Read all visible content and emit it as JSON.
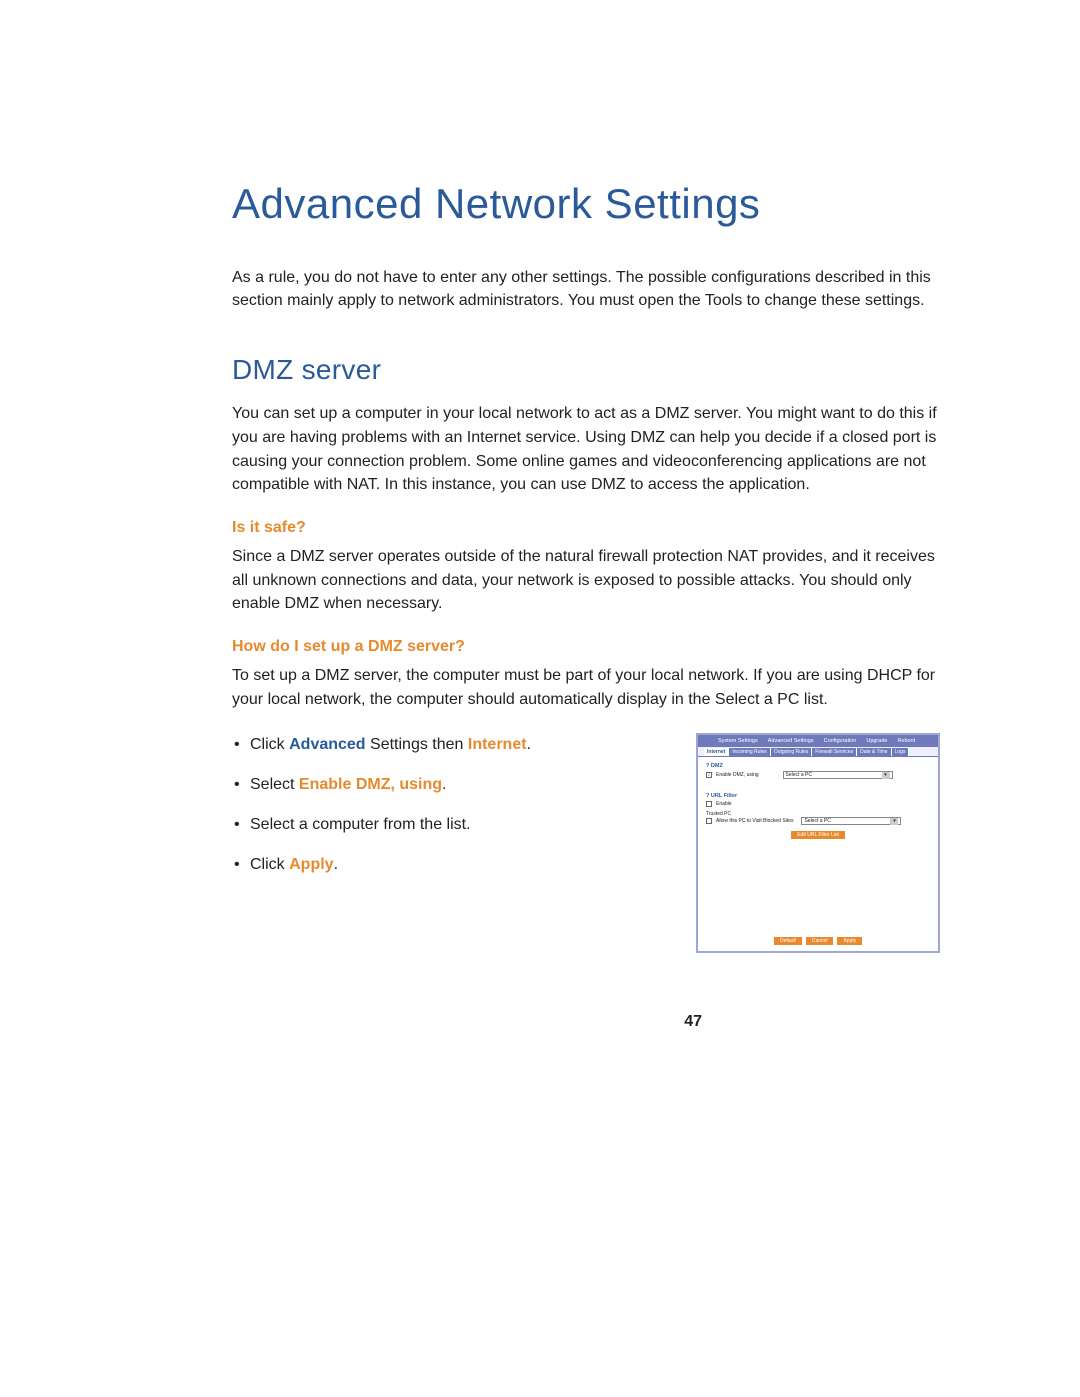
{
  "page": {
    "title": "Advanced Network Settings",
    "intro": "As a rule, you do not have to enter any other settings. The possible configurations described in this section mainly apply to network administrators. You must open the Tools to change these settings.",
    "page_number": "47"
  },
  "dmz": {
    "heading": "DMZ server",
    "body": "You can set up a computer in your local network to act as a DMZ server. You might want to do this if you are having problems with an Internet service. Using DMZ can help you decide if a closed port is causing your connection problem. Some online games and videoconferencing applications are not compatible with NAT. In this instance, you can use DMZ to access the application."
  },
  "safe": {
    "heading": "Is it safe?",
    "body": "Since a DMZ server operates outside of the natural firewall protection NAT provides, and it receives all unknown connections and data, your network is exposed to possible attacks. You should only enable DMZ when necessary."
  },
  "setup": {
    "heading": "How do I set up a DMZ server?",
    "body": "To set up a DMZ server, the computer must be part of your local network. If you are using DHCP for your local network, the computer should automatically display in the Select a PC list.",
    "steps": {
      "s1_pre": "Click ",
      "s1_hl1": "Advanced",
      "s1_mid": " Settings then ",
      "s1_hl2": "Internet",
      "s1_post": ".",
      "s2_pre": "Select ",
      "s2_hl": "Enable DMZ, using",
      "s2_post": ".",
      "s3": "Select a computer from the list.",
      "s4_pre": "Click ",
      "s4_hl": "Apply",
      "s4_post": "."
    }
  },
  "ui": {
    "top_tabs": [
      "System Settings",
      "Advanced Settings",
      "Configuration",
      "Upgrade",
      "Reboot"
    ],
    "sub_tabs": [
      "Internet",
      "Incoming Rules",
      "Outgoing Rules",
      "Firewall Services",
      "Date & Time",
      "Logs"
    ],
    "dmz_title": "DMZ",
    "dmz_enable_label": "Enable DMZ, using",
    "dmz_select": "Select a PC",
    "url_title": "URL Filter",
    "url_enable_label": "Enable",
    "trusted_title": "Trusted PC",
    "trusted_label": "Allow this PC to Visit Blocked Sites",
    "trusted_select": "Select a PC",
    "edit_btn": "Edit URL Filter List",
    "buttons": [
      "Default",
      "Cancel",
      "Apply"
    ]
  }
}
